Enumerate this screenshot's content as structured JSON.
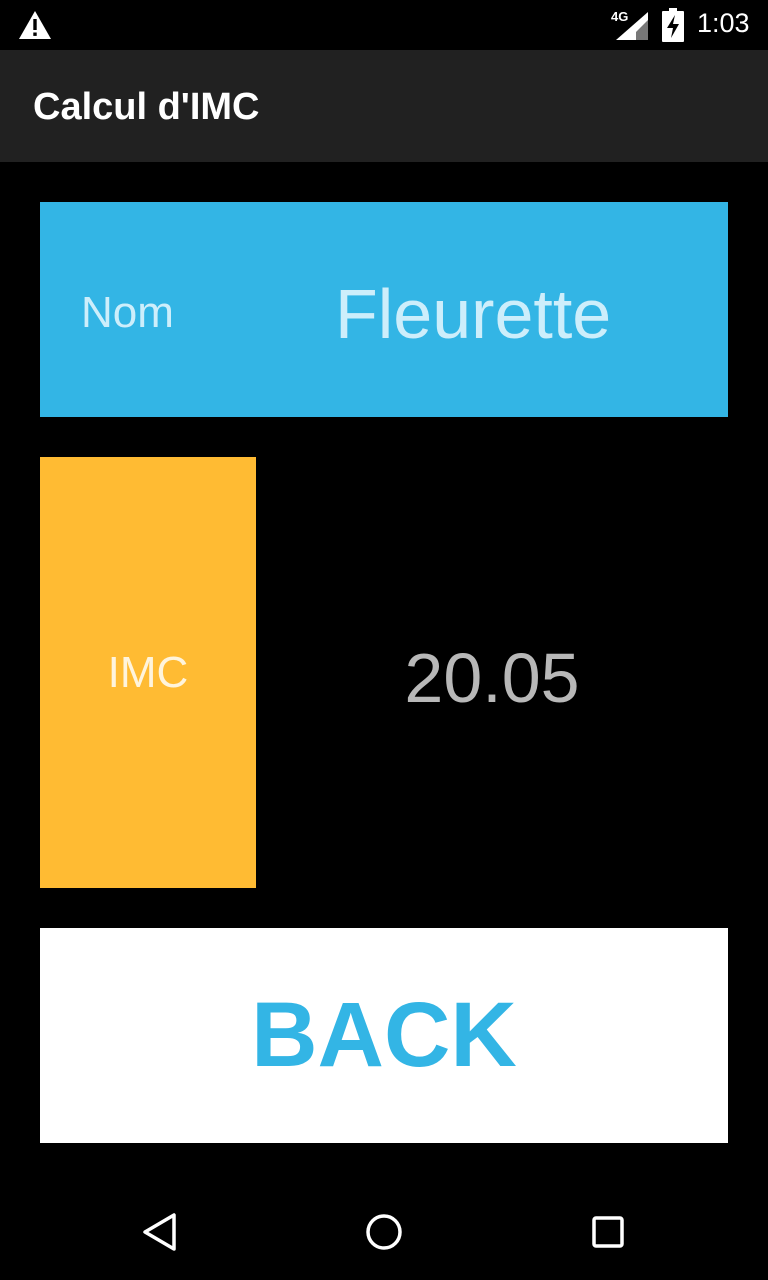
{
  "status_bar": {
    "network_type": "4G",
    "time": "1:03"
  },
  "action_bar": {
    "title": "Calcul d'IMC"
  },
  "name_card": {
    "label": "Nom",
    "value": "Fleurette",
    "background": "#33b5e5"
  },
  "imc_card": {
    "label": "IMC",
    "value": "20.05",
    "background": "#ffbb33"
  },
  "back_button": {
    "label": "BACK",
    "text_color": "#33b5e5"
  },
  "nav_bar": {
    "icons": [
      "back-icon",
      "home-icon",
      "recents-icon"
    ]
  }
}
